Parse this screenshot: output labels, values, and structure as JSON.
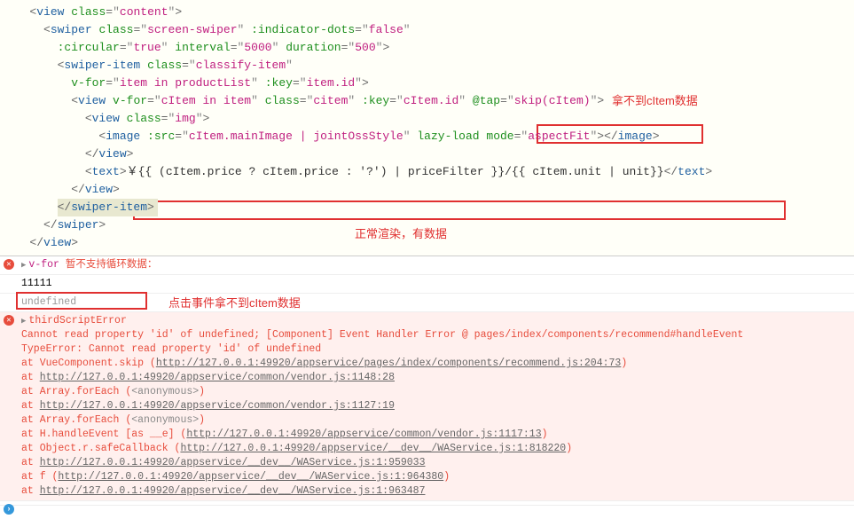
{
  "code": {
    "l1": {
      "tag": "view",
      "cls": "content"
    },
    "l2": {
      "tag": "swiper",
      "cls": "screen-swiper",
      "dots_attr": ":indicator-dots",
      "dots_val": "false"
    },
    "l3": {
      "circ_attr": ":circular",
      "circ_val": "true",
      "int_attr": "interval",
      "int_val": "5000",
      "dur_attr": "duration",
      "dur_val": "500"
    },
    "l4": {
      "tag": "swiper-item",
      "cls": "classify-item"
    },
    "l5": {
      "vfor_attr": "v-for",
      "vfor_val": "item in productList",
      "key_attr": ":key",
      "key_val": "item.id"
    },
    "l6": {
      "tag": "view",
      "vfor_attr": "v-for",
      "vfor_val": "cItem in item",
      "cls_attr": "class",
      "cls_val": "citem",
      "key_attr": ":key",
      "key_val": "cItem.id",
      "tap_attr": "@tap",
      "tap_val": "skip(cItem)"
    },
    "l7": {
      "tag": "view",
      "cls": "img"
    },
    "l8": {
      "tag": "image",
      "src_attr": ":src",
      "src_val": "cItem.mainImage | jointOssStyle",
      "lazy_attr": "lazy-load",
      "mode_attr": "mode",
      "mode_val": "aspectFit",
      "close": "image"
    },
    "l9": {
      "close": "view"
    },
    "l10": {
      "tag": "text",
      "expr": "￥{{ (cItem.price ? cItem.price : '?') | priceFilter }}/{{ cItem.unit | unit}}",
      "close": "text"
    },
    "l11": {
      "close": "view"
    },
    "l12": {
      "close": "swiper-item"
    },
    "l13": {
      "close": "swiper"
    },
    "l14": {
      "close": "view"
    }
  },
  "annotations": {
    "top_right": "拿不到cItem数据",
    "middle": "正常渲染，有数据",
    "console_label": "点击事件拿不到cItem数据"
  },
  "console": {
    "row1_prefix": "v-for",
    "row1_suffix": " 暂不支持循环数据：",
    "row2": "11111",
    "row3": "undefined",
    "err_title": "thirdScriptError",
    "err_line1": "Cannot read property 'id' of undefined; [Component] Event Handler Error @ pages/index/components/recommend#handleEvent",
    "err_line2": "TypeError: Cannot read property 'id' of undefined",
    "traces": [
      {
        "pre": "    at VueComponent.skip (",
        "link": "http://127.0.0.1:49920/appservice/pages/index/components/recommend.js:204:73",
        "post": ")"
      },
      {
        "pre": "    at ",
        "link": "http://127.0.0.1:49920/appservice/common/vendor.js:1148:28",
        "post": ""
      },
      {
        "pre": "    at Array.forEach (",
        "anon": "<anonymous>",
        "post": ")"
      },
      {
        "pre": "    at ",
        "link": "http://127.0.0.1:49920/appservice/common/vendor.js:1127:19",
        "post": ""
      },
      {
        "pre": "    at Array.forEach (",
        "anon": "<anonymous>",
        "post": ")"
      },
      {
        "pre": "    at H.handleEvent [as __e] (",
        "link": "http://127.0.0.1:49920/appservice/common/vendor.js:1117:13",
        "post": ")"
      },
      {
        "pre": "    at Object.r.safeCallback (",
        "link": "http://127.0.0.1:49920/appservice/__dev__/WAService.js:1:818220",
        "post": ")"
      },
      {
        "pre": "    at ",
        "link": "http://127.0.0.1:49920/appservice/__dev__/WAService.js:1:959033",
        "post": ""
      },
      {
        "pre": "    at f (",
        "link": "http://127.0.0.1:49920/appservice/__dev__/WAService.js:1:964380",
        "post": ")"
      },
      {
        "pre": "    at ",
        "link": "http://127.0.0.1:49920/appservice/__dev__/WAService.js:1:963487",
        "post": ""
      }
    ]
  }
}
